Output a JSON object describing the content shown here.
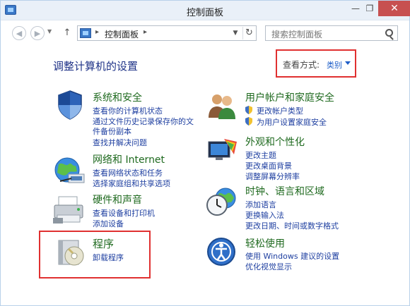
{
  "window": {
    "title": "控制面板"
  },
  "nav": {
    "address": "控制面板",
    "search_placeholder": "搜索控制面板"
  },
  "main": {
    "heading": "调整计算机的设置",
    "view_label": "查看方式:",
    "view_value": "类别"
  },
  "categories": [
    {
      "title": "系统和安全",
      "links": [
        "查看你的计算机状态",
        "通过文件历史记录保存你的文",
        "件备份副本",
        "查找并解决问题"
      ]
    },
    {
      "title": "网络和 Internet",
      "links": [
        "查看网络状态和任务",
        "选择家庭组和共享选项"
      ]
    },
    {
      "title": "硬件和声音",
      "links": [
        "查看设备和打印机",
        "添加设备"
      ]
    },
    {
      "title": "程序",
      "links": [
        "卸载程序"
      ]
    },
    {
      "title": "用户帐户和家庭安全",
      "links": [
        "更改帐户类型",
        "为用户设置家庭安全"
      ]
    },
    {
      "title": "外观和个性化",
      "links": [
        "更改主题",
        "更改桌面背景",
        "调整屏幕分辨率"
      ]
    },
    {
      "title": "时钟、语言和区域",
      "links": [
        "添加语言",
        "更换输入法",
        "更改日期、时间或数字格式"
      ]
    },
    {
      "title": "轻松使用",
      "links": [
        "使用 Windows 建议的设置",
        "优化视觉显示"
      ]
    }
  ],
  "icons": {
    "system": "shield-icon",
    "network": "globe-network-icon",
    "hardware": "printer-icon",
    "programs": "software-box-icon",
    "users": "users-icon",
    "appearance": "monitor-palette-icon",
    "clock": "clock-globe-icon",
    "ease": "ease-of-access-icon"
  },
  "colors": {
    "category_title": "#1f6a1f",
    "link": "#1e3fa0",
    "heading": "#1e3287",
    "highlight": "#e03030"
  }
}
